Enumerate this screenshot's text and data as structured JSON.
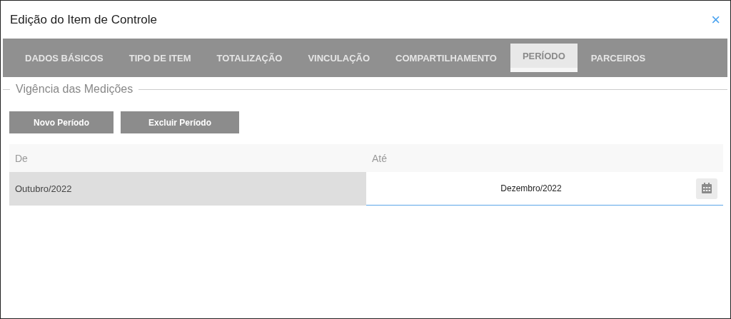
{
  "window": {
    "title": "Edição do Item de Controle",
    "close": "×"
  },
  "tabs": [
    {
      "label": "DADOS BÁSICOS",
      "selected": false
    },
    {
      "label": "TIPO DE ITEM",
      "selected": false
    },
    {
      "label": "TOTALIZAÇÃO",
      "selected": false
    },
    {
      "label": "VINCULAÇÃO",
      "selected": false
    },
    {
      "label": "COMPARTILHAMENTO",
      "selected": false
    },
    {
      "label": "PERÍODO",
      "selected": true
    },
    {
      "label": "PARCEIROS",
      "selected": false
    }
  ],
  "section": {
    "legend": "Vigência das Medições"
  },
  "buttons": [
    "Novo Período",
    "Excluir Período"
  ],
  "table": {
    "columns": [
      "De",
      "Até"
    ],
    "rows": [
      {
        "from": "Outubro/2022",
        "to": "Dezembro/2022"
      }
    ]
  }
}
